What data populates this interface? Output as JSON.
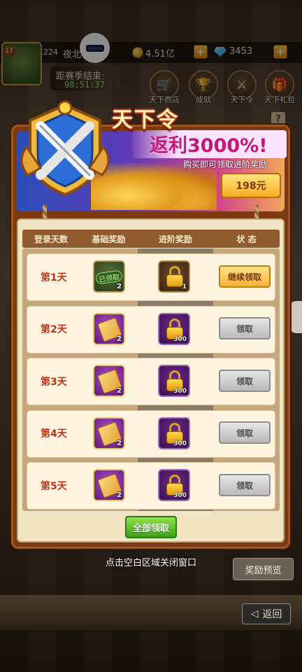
{
  "hud": {
    "level": "17",
    "power": "224",
    "player_name": "夜北",
    "gold": "4.51亿",
    "gems": "3453",
    "season_label": "距赛季结束:",
    "season_timer": "98:51:37"
  },
  "top_icons": [
    {
      "label": "天下商店",
      "icon": "cart-icon"
    },
    {
      "label": "成就",
      "icon": "trophy-icon"
    },
    {
      "label": "天下令",
      "icon": "swords-icon"
    },
    {
      "label": "天下礼包",
      "icon": "gift-icon"
    }
  ],
  "banner": {
    "title": "天下令",
    "rebate": "返利3000%!",
    "subtitle": "购买即可领取进阶奖励",
    "price": "198元"
  },
  "table": {
    "headers": [
      "登录天数",
      "基础奖励",
      "进阶奖励",
      "状 态"
    ],
    "rows": [
      {
        "day": "第1天",
        "basic_qty": "2",
        "basic_claimed": "已领取",
        "adv_qty": "1",
        "status": "继续领取"
      },
      {
        "day": "第2天",
        "basic_qty": "2",
        "adv_qty": "300",
        "status": "领取"
      },
      {
        "day": "第3天",
        "basic_qty": "2",
        "adv_qty": "300",
        "status": "领取"
      },
      {
        "day": "第4天",
        "basic_qty": "2",
        "adv_qty": "300",
        "status": "领取"
      },
      {
        "day": "第5天",
        "basic_qty": "2",
        "adv_qty": "300",
        "status": "领取"
      }
    ]
  },
  "claim_all": "全部领取",
  "close_hint": "点击空白区域关闭窗口",
  "preview_button": "奖励预览",
  "back_button": "返回",
  "help": "?",
  "colors": {
    "accent_gold": "#f3b238",
    "claim_green": "#3fa21a",
    "day_red": "#c33410"
  }
}
